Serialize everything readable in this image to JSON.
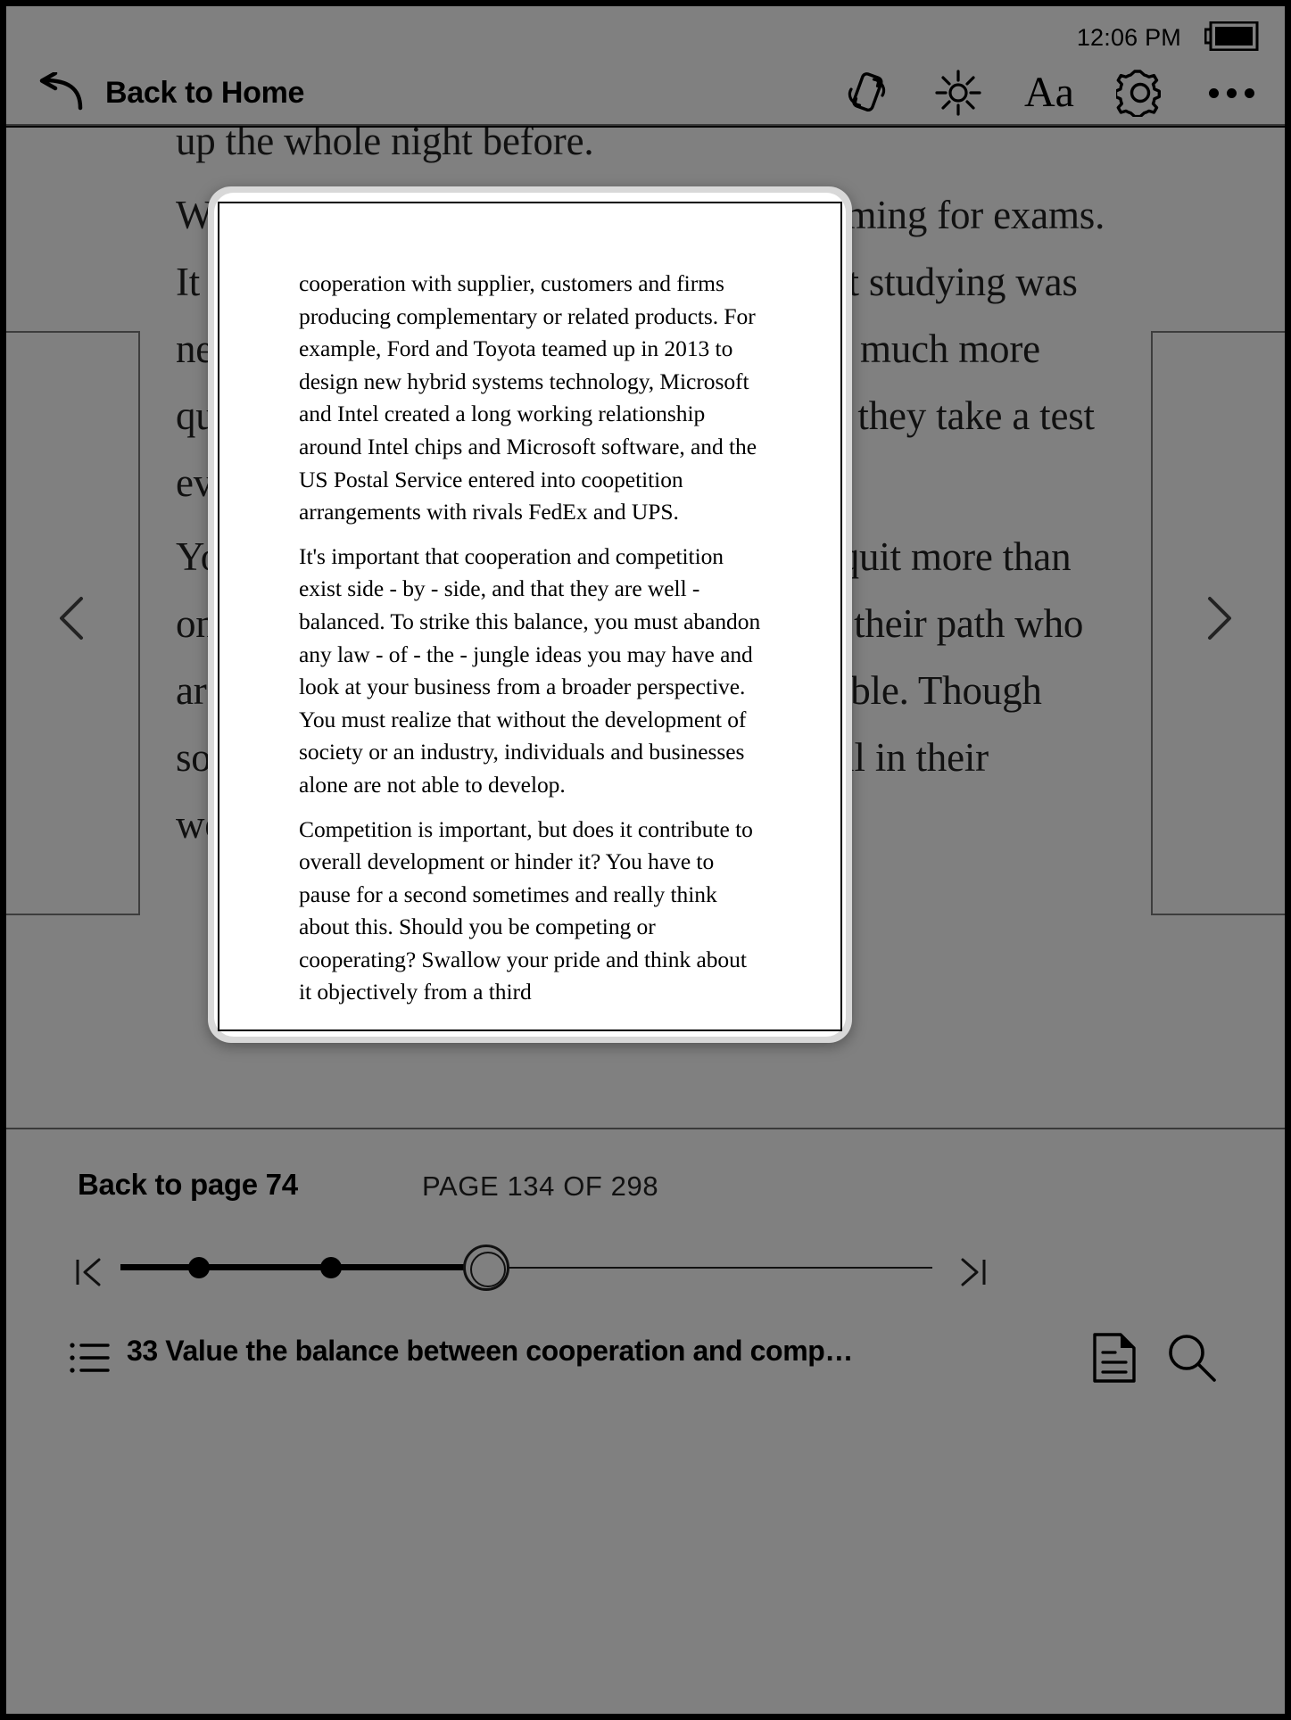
{
  "status": {
    "time": "12:06 PM",
    "battery_icon": "battery-icon"
  },
  "toolbar": {
    "back_label": "Back to Home",
    "back_icon": "back-arrow-icon",
    "icons": [
      {
        "name": "screen-rotation-icon",
        "label": "Rotate"
      },
      {
        "name": "brightness-icon",
        "label": "Brightness"
      },
      {
        "name": "font-size-icon",
        "label": "Aa"
      },
      {
        "name": "settings-gear-icon",
        "label": "Settings"
      },
      {
        "name": "more-options-icon",
        "label": "More"
      }
    ],
    "aa_label": "Aa"
  },
  "reader": {
    "paragraphs": [
      "up the whole night before.",
      "When I was in college, I was always cramming for exams. It felt great when I got high marks, but that studying was never in - depth, learned little and forgot it much more quickly. A lot of people quit smoking after they take a test every so often and the problem goes away.",
      "You've probably heard of someone who's quit more than once. In my personal experience, those on their path who are continually improving is the most reliable. Though some may not have encountered them at all in their working lives. But the reason it"
    ]
  },
  "popup": {
    "paragraphs": [
      "cooperation with supplier, customers and firms producing complementary or related products. For example, Ford and Toyota teamed up in 2013 to design new hybrid systems technology, Microsoft and Intel created a long working relationship around Intel chips and Microsoft software, and the US Postal Service entered into coopetition arrangements with rivals FedEx and UPS.",
      "It's important that cooperation and competition exist side - by - side, and that they are well - balanced. To strike this balance, you must abandon any law - of - the - jungle ideas you may have and look at your business from a broader perspective. You must realize that without the development of society or an industry, individuals and businesses alone are not able to develop.",
      "Competition is important, but does it contribute to overall development or hinder it? You have to pause for a second sometimes and really think about this. Should you be competing or cooperating? Swallow your pride and think about it objectively from a third"
    ]
  },
  "footer": {
    "back_to_page": "Back to page 74",
    "page_indicator": "PAGE 134 OF 298",
    "chapter_title": "33 Value the balance between cooperation and comp…",
    "slider": {
      "jump_start_icon": "jump-to-start-icon",
      "jump_end_icon": "jump-to-end-icon",
      "handle_icon": "slider-handle",
      "bookmark_count": 2
    },
    "toc_icon": "table-of-contents-icon",
    "doc_icon": "document-icon",
    "search_icon": "search-icon"
  },
  "colors": {
    "dimmed_page": "#808080",
    "popup_bg": "#ffffff",
    "ink": "#000000",
    "bezel": "#000000"
  }
}
